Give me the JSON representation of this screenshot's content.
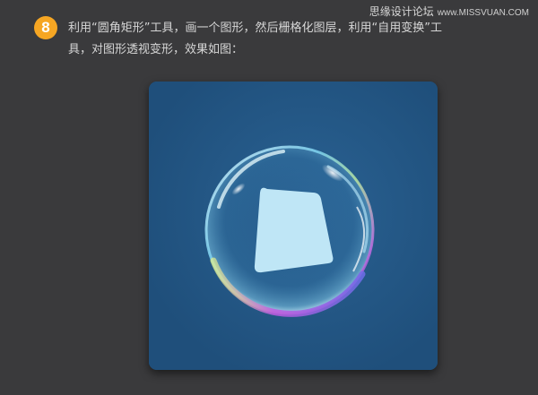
{
  "watermark": {
    "cn": "思缘设计论坛",
    "site": "www.MISSVUAN.COM"
  },
  "step": {
    "number": "8",
    "line1": "利用“圆角矩形”工具，画一个图形，然后栅格化图层，利用“自用变换”工",
    "line2": "具，对图形透视变形，效果如图："
  },
  "colors": {
    "page_background": "#3a3a3c",
    "canvas_background": "#1f4f7b",
    "badge": "#f6a623",
    "shape_fill": "#bfe6f6"
  },
  "illustration": {
    "icons": [
      "bubble-sphere",
      "perspective-rounded-rectangle"
    ]
  }
}
